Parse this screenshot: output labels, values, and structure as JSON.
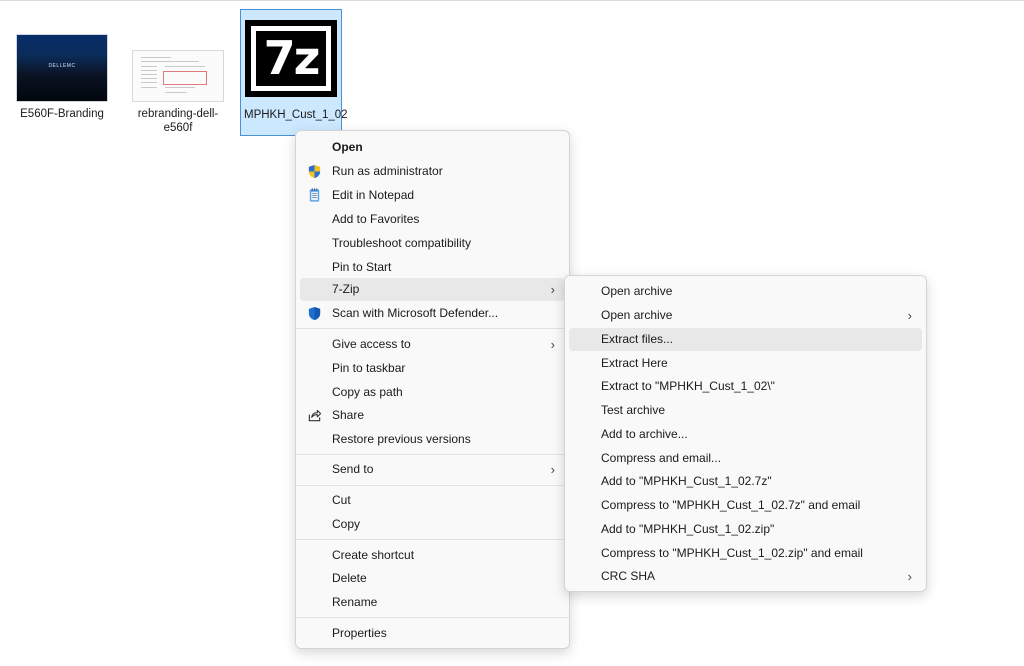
{
  "files": [
    {
      "name": "E560F-Branding",
      "thumb_text": "DELLEMC"
    },
    {
      "name": "rebranding-dell-e560f"
    },
    {
      "name": "MPHKH_Cust_1_02",
      "thumb_text": "7z"
    }
  ],
  "context_menu": {
    "items": [
      {
        "label": "Open",
        "icon": "none"
      },
      {
        "label": "Run as administrator",
        "icon": "uac-shield-icon"
      },
      {
        "label": "Edit in Notepad",
        "icon": "notepad-icon"
      },
      {
        "label": "Add to Favorites",
        "icon": "none"
      },
      {
        "label": "Troubleshoot compatibility",
        "icon": "none"
      },
      {
        "label": "Pin to Start",
        "icon": "none"
      },
      {
        "label": "7-Zip",
        "icon": "none",
        "submenu_arrow": "›"
      },
      {
        "label": "Scan with Microsoft Defender...",
        "icon": "defender-shield-icon"
      },
      {
        "label": "Give access to",
        "icon": "none",
        "submenu_arrow": "›"
      },
      {
        "label": "Pin to taskbar",
        "icon": "none"
      },
      {
        "label": "Copy as path",
        "icon": "none"
      },
      {
        "label": "Share",
        "icon": "share-icon"
      },
      {
        "label": "Restore previous versions",
        "icon": "none"
      },
      {
        "label": "Send to",
        "icon": "none",
        "submenu_arrow": "›"
      },
      {
        "label": "Cut",
        "icon": "none"
      },
      {
        "label": "Copy",
        "icon": "none"
      },
      {
        "label": "Create shortcut",
        "icon": "none"
      },
      {
        "label": "Delete",
        "icon": "none"
      },
      {
        "label": "Rename",
        "icon": "none"
      },
      {
        "label": "Properties",
        "icon": "none"
      }
    ]
  },
  "zip_submenu": {
    "items": [
      {
        "label": "Open archive"
      },
      {
        "label": "Open archive",
        "submenu_arrow": "›"
      },
      {
        "label": "Extract files..."
      },
      {
        "label": "Extract Here"
      },
      {
        "label": "Extract to \"MPHKH_Cust_1_02\\\""
      },
      {
        "label": "Test archive"
      },
      {
        "label": "Add to archive..."
      },
      {
        "label": "Compress and email..."
      },
      {
        "label": "Add to \"MPHKH_Cust_1_02.7z\""
      },
      {
        "label": "Compress to \"MPHKH_Cust_1_02.7z\" and email"
      },
      {
        "label": "Add to \"MPHKH_Cust_1_02.zip\""
      },
      {
        "label": "Compress to \"MPHKH_Cust_1_02.zip\" and email"
      },
      {
        "label": "CRC SHA",
        "submenu_arrow": "›"
      }
    ]
  },
  "colors": {
    "selection_fill": "#cce8ff",
    "selection_border": "#4a90d9",
    "menu_background": "#f9f9f9",
    "hover_background": "#e8e8e8",
    "defender_blue": "#1f6fd1",
    "uac_yellow": "#f2c21b"
  }
}
